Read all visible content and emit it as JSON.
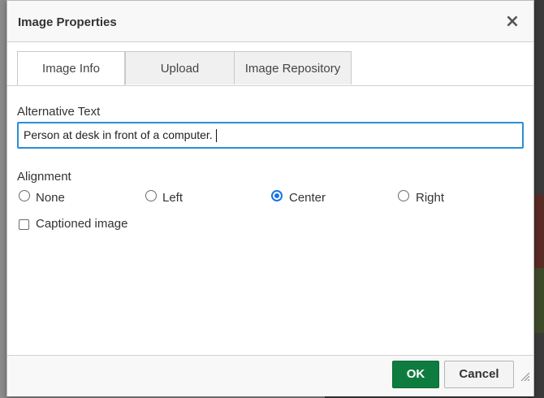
{
  "dialog": {
    "title": "Image Properties",
    "close_symbol": "×"
  },
  "tabs": [
    {
      "label": "Image Info",
      "active": true
    },
    {
      "label": "Upload",
      "active": false
    },
    {
      "label": "Image Repository",
      "active": false
    }
  ],
  "alt_text": {
    "label": "Alternative Text",
    "value": "Person at desk in front of a computer."
  },
  "alignment": {
    "label": "Alignment",
    "options": [
      {
        "label": "None",
        "checked": false
      },
      {
        "label": "Left",
        "checked": false
      },
      {
        "label": "Center",
        "checked": true
      },
      {
        "label": "Right",
        "checked": false
      }
    ]
  },
  "captioned": {
    "label": "Captioned image",
    "checked": false
  },
  "footer": {
    "ok_label": "OK",
    "cancel_label": "Cancel"
  },
  "colors": {
    "accent_focus": "#2a8fd6",
    "radio_checked": "#1a73e8",
    "ok_button": "#0f7c3f"
  },
  "icons": {
    "close": "close-icon",
    "resize": "resize-grip-icon"
  }
}
